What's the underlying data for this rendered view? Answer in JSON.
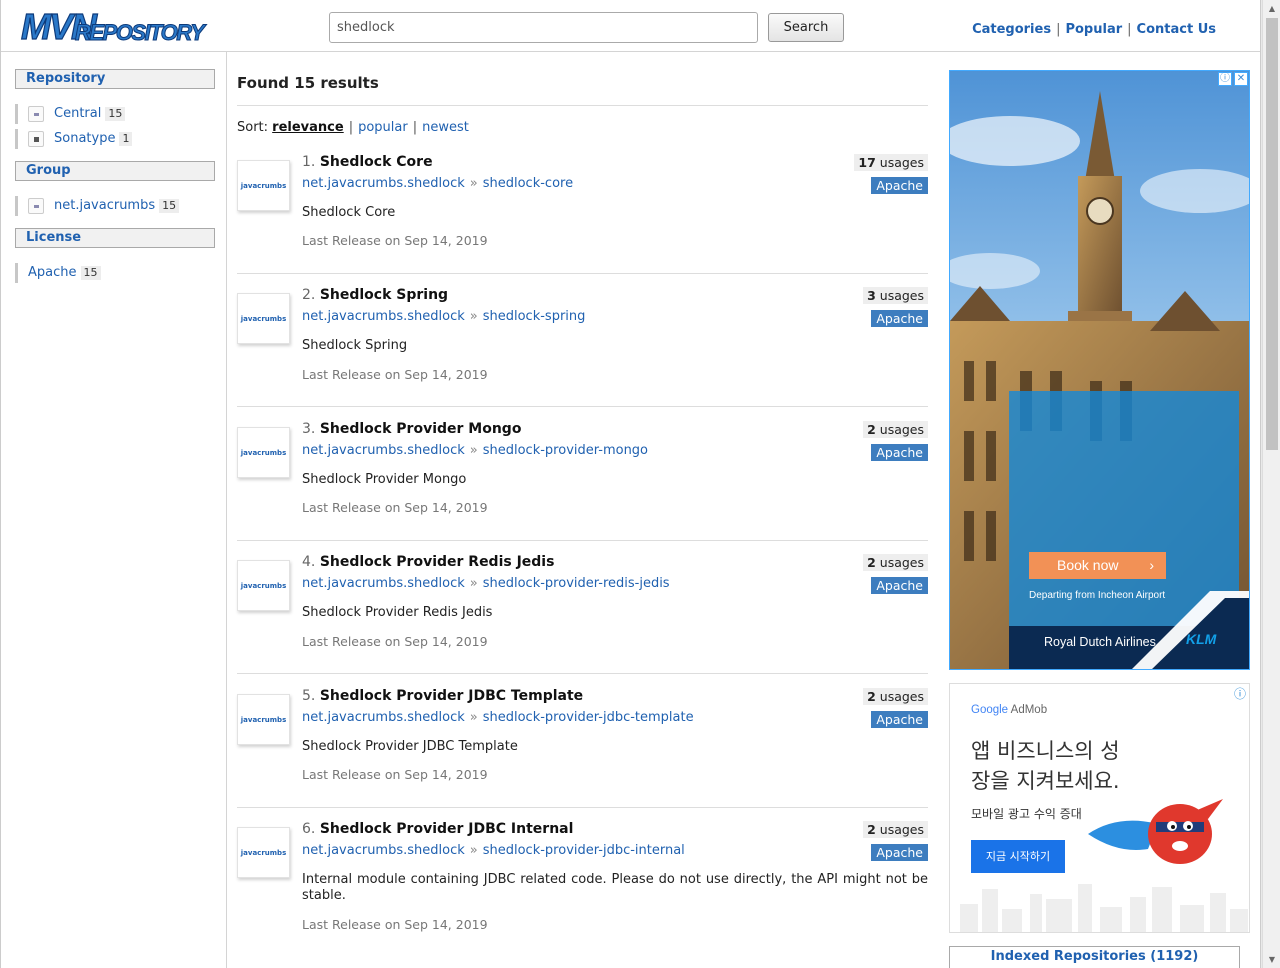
{
  "header": {
    "logo": "MVNREPOSITORY",
    "search_value": "shedlock",
    "search_button": "Search",
    "nav": [
      "Categories",
      "Popular",
      "Contact Us"
    ],
    "nav_sep": "|"
  },
  "sidebar": {
    "repository": {
      "title": "Repository",
      "items": [
        {
          "label": "Central",
          "count": "15"
        },
        {
          "label": "Sonatype",
          "count": "1"
        }
      ]
    },
    "group": {
      "title": "Group",
      "items": [
        {
          "label": "net.javacrumbs",
          "count": "15"
        }
      ]
    },
    "license": {
      "title": "License",
      "items": [
        {
          "label": "Apache",
          "count": "15"
        }
      ]
    }
  },
  "main": {
    "found": "Found 15 results",
    "sort_label": "Sort:",
    "sort_options": [
      "relevance",
      "popular",
      "newest"
    ],
    "sort_sep": "|",
    "coord_arrow": "»",
    "usages_word": "usages",
    "results": [
      {
        "num": "1.",
        "name": "Shedlock Core",
        "group": "net.javacrumbs.shedlock",
        "artifact": "shedlock-core",
        "desc": "Shedlock Core",
        "date": "Last Release on Sep 14, 2019",
        "usages": "17",
        "license": "Apache",
        "icon_text": "javacrumbs"
      },
      {
        "num": "2.",
        "name": "Shedlock Spring",
        "group": "net.javacrumbs.shedlock",
        "artifact": "shedlock-spring",
        "desc": "Shedlock Spring",
        "date": "Last Release on Sep 14, 2019",
        "usages": "3",
        "license": "Apache",
        "icon_text": "javacrumbs"
      },
      {
        "num": "3.",
        "name": "Shedlock Provider Mongo",
        "group": "net.javacrumbs.shedlock",
        "artifact": "shedlock-provider-mongo",
        "desc": "Shedlock Provider Mongo",
        "date": "Last Release on Sep 14, 2019",
        "usages": "2",
        "license": "Apache",
        "icon_text": "javacrumbs"
      },
      {
        "num": "4.",
        "name": "Shedlock Provider Redis Jedis",
        "group": "net.javacrumbs.shedlock",
        "artifact": "shedlock-provider-redis-jedis",
        "desc": "Shedlock Provider Redis Jedis",
        "date": "Last Release on Sep 14, 2019",
        "usages": "2",
        "license": "Apache",
        "icon_text": "javacrumbs"
      },
      {
        "num": "5.",
        "name": "Shedlock Provider JDBC Template",
        "group": "net.javacrumbs.shedlock",
        "artifact": "shedlock-provider-jdbc-template",
        "desc": "Shedlock Provider JDBC Template",
        "date": "Last Release on Sep 14, 2019",
        "usages": "2",
        "license": "Apache",
        "icon_text": "javacrumbs"
      },
      {
        "num": "6.",
        "name": "Shedlock Provider JDBC Internal",
        "group": "net.javacrumbs.shedlock",
        "artifact": "shedlock-provider-jdbc-internal",
        "desc": "Internal module containing JDBC related code. Please do not use directly, the API might not be stable.",
        "date": "Last Release on Sep 14, 2019",
        "usages": "2",
        "license": "Apache",
        "icon_text": "javacrumbs"
      }
    ]
  },
  "ads": {
    "ad1": {
      "button": "Book now",
      "chevron": "›",
      "caption": "Departing from Incheon Airport",
      "airline": "Royal Dutch Airlines",
      "logo": "KLM",
      "info": "ⓘ",
      "close": "✕"
    },
    "ad2": {
      "brand_google": "Google",
      "brand_admob": "AdMob",
      "headline_1": "앱 비즈니스의 성",
      "headline_2": "장을 지켜보세요.",
      "sub": "모바일 광고 수익 증대",
      "cta": "지금 시작하기",
      "info": "ⓘ"
    },
    "indexed": "Indexed Repositories (1192)"
  },
  "colors": {
    "link": "#2061b0",
    "license_badge": "#3d7dbf",
    "ad_orange": "#f29156",
    "ad_blue": "#1488d8",
    "admob_button": "#1a73e8"
  }
}
